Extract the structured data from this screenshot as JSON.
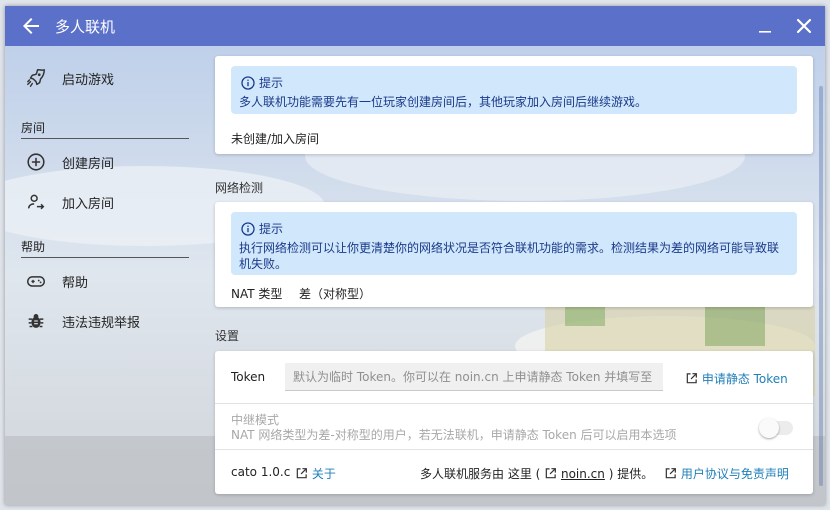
{
  "window": {
    "title": "多人联机"
  },
  "sidebar": {
    "items": [
      {
        "label": "启动游戏",
        "icon": "rocket-icon"
      },
      {
        "label": "创建房间",
        "icon": "plus-circle-icon"
      },
      {
        "label": "加入房间",
        "icon": "person-arrow-icon"
      },
      {
        "label": "帮助",
        "icon": "gamepad-icon"
      },
      {
        "label": "违法违规举报",
        "icon": "bug-icon"
      }
    ],
    "sections": {
      "room": "房间",
      "help": "帮助"
    }
  },
  "room_card": {
    "hint_title": "提示",
    "hint_text": "多人联机功能需要先有一位玩家创建房间后，其他玩家加入房间后继续游戏。",
    "status": "未创建/加入房间"
  },
  "network": {
    "section_label": "网络检测",
    "hint_title": "提示",
    "hint_text": "执行网络检测可以让你更清楚你的网络状况是否符合联机功能的需求。检测结果为差的网络可能导致联机失败。",
    "nat_label": "NAT 类型",
    "nat_value": "差（对称型）"
  },
  "settings": {
    "section_label": "设置",
    "token_label": "Token",
    "token_placeholder": "默认为临时 Token。你可以在 noin.cn 上申请静态 Token 并填写至",
    "token_link": "申请静态 Token",
    "relay_title": "中继模式",
    "relay_desc": "NAT 网络类型为差-对称型的用户，若无法联机，申请静态 Token 后可以启用本选项",
    "relay_enabled": false,
    "version": "cato 1.0.c",
    "about_link": "关于",
    "provider_prefix": "多人联机服务由 这里 (",
    "provider_link": "noin.cn",
    "provider_suffix": ") 提供。",
    "terms_link": "用户协议与免责声明"
  },
  "colors": {
    "titlebar": "#5b70c8",
    "hint_bg": "#d1e7fb",
    "link": "#1f7fb8"
  }
}
